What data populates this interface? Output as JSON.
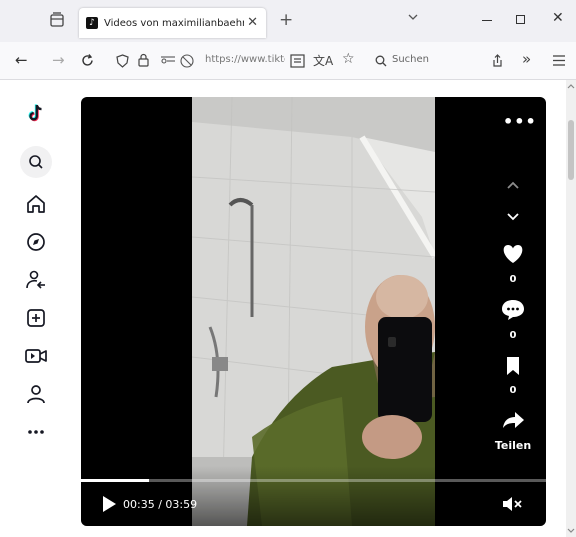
{
  "browser": {
    "tab": {
      "title": "Videos von maximilianbaehring",
      "favicon": "tiktok-favicon"
    },
    "url": "https://www.tiktok.com",
    "search_placeholder": "Suchen"
  },
  "sidebar": {
    "items": [
      {
        "icon": "tiktok-logo-icon"
      },
      {
        "icon": "search-icon"
      },
      {
        "icon": "home-icon"
      },
      {
        "icon": "explore-icon"
      },
      {
        "icon": "following-icon"
      },
      {
        "icon": "upload-icon"
      },
      {
        "icon": "live-icon"
      },
      {
        "icon": "profile-icon"
      },
      {
        "icon": "more-icon"
      }
    ]
  },
  "player": {
    "time": "00:35 / 03:59",
    "progress": 0.146,
    "likes": "0",
    "comments": "0",
    "saves": "0",
    "share_label": "Teilen",
    "muted": true
  },
  "colors": {
    "video_bg": "#000000",
    "page_bg": "#ffffff",
    "browser_chrome": "#f0f0f4"
  }
}
